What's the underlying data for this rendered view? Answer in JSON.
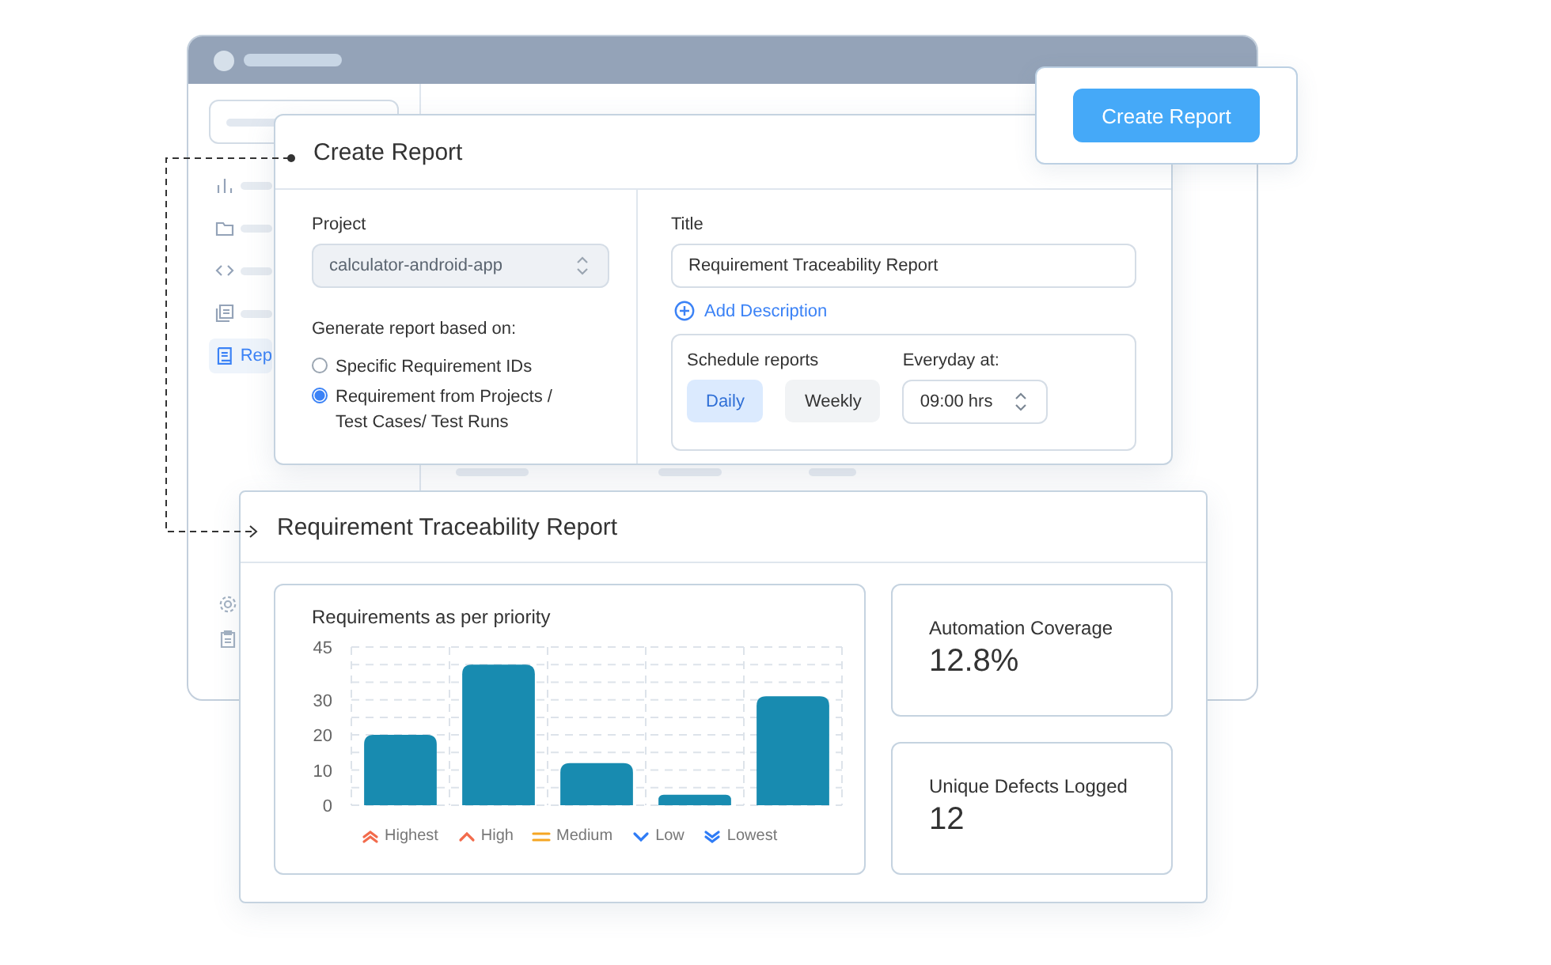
{
  "background_window": {
    "sidebar": {
      "items": [
        {
          "kind": "chart",
          "selected": false
        },
        {
          "kind": "folder",
          "selected": false
        },
        {
          "kind": "code",
          "selected": false
        },
        {
          "kind": "document",
          "selected": false
        },
        {
          "kind": "report",
          "label": "Rep",
          "selected": true
        }
      ],
      "footer_items": [
        {
          "kind": "gear"
        },
        {
          "kind": "clipboard"
        }
      ]
    }
  },
  "create_button": "Create Report",
  "create_dialog": {
    "title": "Create Report",
    "project_label": "Project",
    "project_value": "calculator-android-app",
    "basis_label": "Generate report based on:",
    "basis_options": [
      {
        "label": "Specific Requirement IDs",
        "selected": false
      },
      {
        "label": "Requirement from Projects / Test Cases/ Test Runs",
        "selected": true
      }
    ],
    "title_label": "Title",
    "title_value": "Requirement Traceability Report",
    "add_description": "Add Description",
    "schedule_label": "Schedule reports",
    "schedule_options": [
      {
        "label": "Daily",
        "selected": true
      },
      {
        "label": "Weekly",
        "selected": false
      }
    ],
    "time_label": "Everyday at:",
    "time_value": "09:00 hrs"
  },
  "report": {
    "title": "Requirement Traceability Report",
    "chart": {
      "chart_data": {
        "type": "bar",
        "title": "Requirements as per priority",
        "categories": [
          "Highest",
          "High",
          "Medium",
          "Low",
          "Lowest"
        ],
        "values": [
          20,
          40,
          12,
          3,
          31
        ],
        "ylim": [
          0,
          45
        ],
        "grid": true,
        "yticks": [
          0,
          10,
          20,
          30,
          45
        ]
      },
      "category_marks": [
        {
          "kind": "double-up",
          "color": "#f26b4c"
        },
        {
          "kind": "up",
          "color": "#f26b4c"
        },
        {
          "kind": "equal",
          "color": "#f5a623"
        },
        {
          "kind": "down",
          "color": "#2f7cf6"
        },
        {
          "kind": "double-down",
          "color": "#2f7cf6"
        }
      ]
    },
    "stats": [
      {
        "label": "Automation Coverage",
        "value": "12.8%"
      },
      {
        "label": "Unique Defects Logged",
        "value": "12"
      }
    ]
  }
}
